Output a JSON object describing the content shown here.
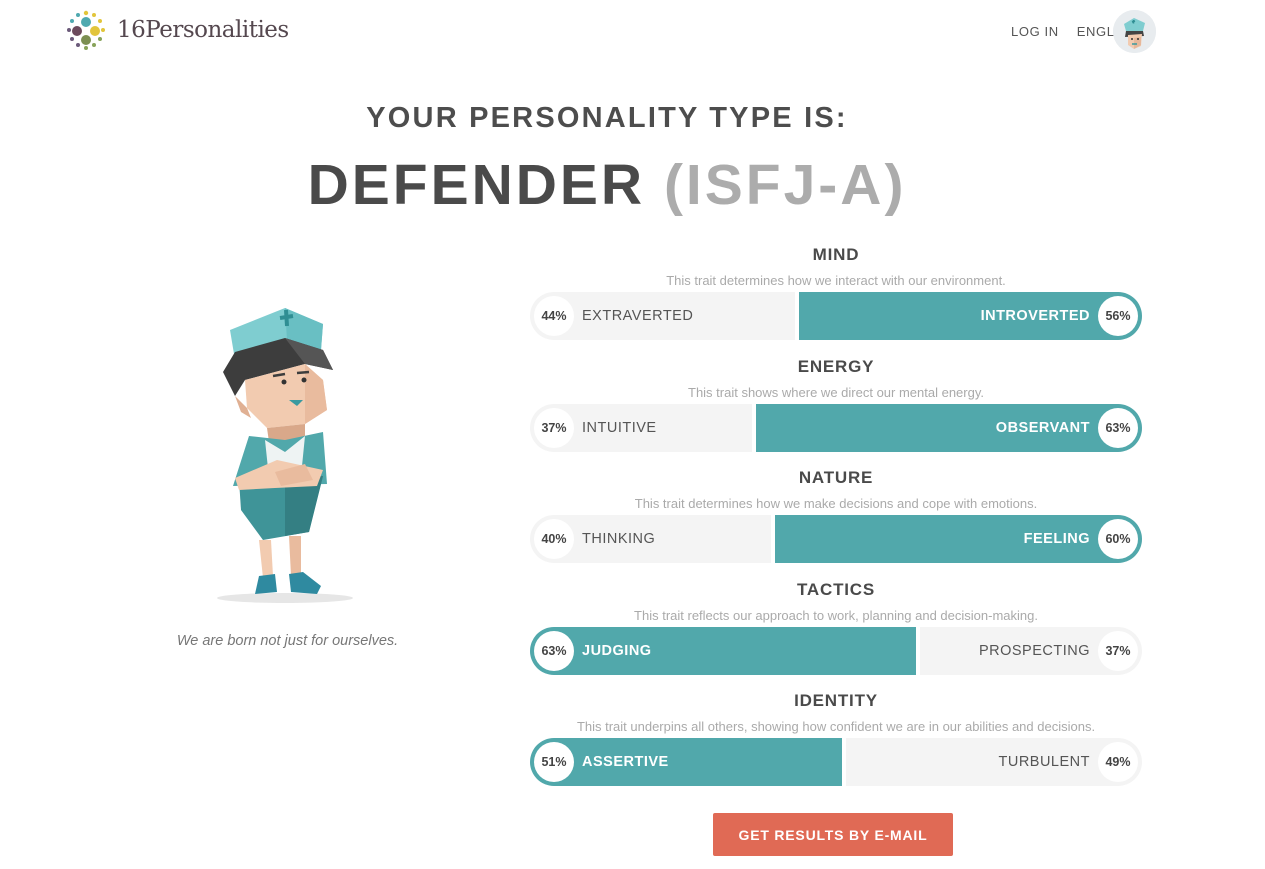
{
  "header": {
    "logo_text": "16Personalities",
    "login_label": "LOG IN",
    "language_label": "ENGLISH",
    "icons": {
      "logo": "dots-circle-logo",
      "globe": "globe-icon",
      "avatar": "nurse-avatar"
    }
  },
  "result": {
    "heading": "YOUR PERSONALITY TYPE IS:",
    "type_name": "DEFENDER",
    "type_code": "(ISFJ-A)",
    "quote": "We are born not just for ourselves."
  },
  "traits": [
    {
      "name": "MIND",
      "description": "This trait determines how we interact with our environment.",
      "left_label": "EXTRAVERTED",
      "left_pct": "44%",
      "right_label": "INTROVERTED",
      "right_pct": "56%",
      "dominant": "right",
      "dominant_value": 56
    },
    {
      "name": "ENERGY",
      "description": "This trait shows where we direct our mental energy.",
      "left_label": "INTUITIVE",
      "left_pct": "37%",
      "right_label": "OBSERVANT",
      "right_pct": "63%",
      "dominant": "right",
      "dominant_value": 63
    },
    {
      "name": "NATURE",
      "description": "This trait determines how we make decisions and cope with emotions.",
      "left_label": "THINKING",
      "left_pct": "40%",
      "right_label": "FEELING",
      "right_pct": "60%",
      "dominant": "right",
      "dominant_value": 60
    },
    {
      "name": "TACTICS",
      "description": "This trait reflects our approach to work, planning and decision-making.",
      "left_label": "JUDGING",
      "left_pct": "63%",
      "right_label": "PROSPECTING",
      "right_pct": "37%",
      "dominant": "left",
      "dominant_value": 63
    },
    {
      "name": "IDENTITY",
      "description": "This trait underpins all others, showing how confident we are in our abilities and decisions.",
      "left_label": "ASSERTIVE",
      "left_pct": "51%",
      "right_label": "TURBULENT",
      "right_pct": "49%",
      "dominant": "left",
      "dominant_value": 51
    }
  ],
  "actions": {
    "email_button": "GET RESULTS BY E-MAIL"
  },
  "colors": {
    "accent": "#51a8ab",
    "track": "#f4f4f4",
    "button": "#e06a55",
    "muted_code": "#acacac"
  }
}
